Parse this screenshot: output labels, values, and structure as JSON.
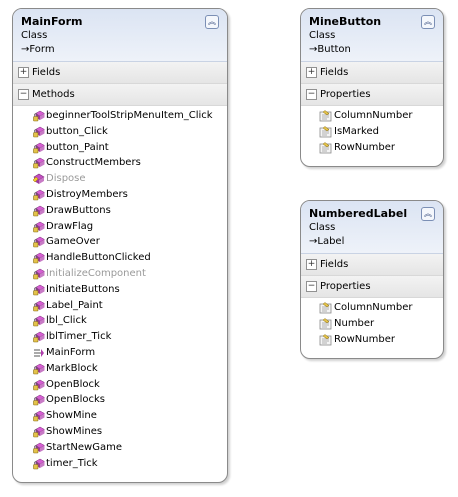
{
  "colors": {
    "header_bg": "#dbe4f3",
    "method_icon": "#b03fae",
    "lock_icon": "#c9a227",
    "dim_text": "#9a9a9a"
  },
  "main_form": {
    "name": "MainForm",
    "kind": "Class",
    "base": "→Form",
    "fields_label": "Fields",
    "methods_label": "Methods",
    "methods": [
      {
        "name": "beginnerToolStripMenuItem_Click",
        "icon": "private-method-icon"
      },
      {
        "name": "button_Click",
        "icon": "private-method-icon"
      },
      {
        "name": "button_Paint",
        "icon": "private-method-icon"
      },
      {
        "name": "ConstructMembers",
        "icon": "private-method-icon"
      },
      {
        "name": "Dispose",
        "icon": "protected-method-icon"
      },
      {
        "name": "DistroyMembers",
        "icon": "private-method-icon"
      },
      {
        "name": "DrawButtons",
        "icon": "private-method-icon"
      },
      {
        "name": "DrawFlag",
        "icon": "private-method-icon"
      },
      {
        "name": "GameOver",
        "icon": "private-method-icon"
      },
      {
        "name": "HandleButtonClicked",
        "icon": "private-method-icon"
      },
      {
        "name": "InitializeComponent",
        "icon": "private-method-icon"
      },
      {
        "name": "InitiateButtons",
        "icon": "private-method-icon"
      },
      {
        "name": "Label_Paint",
        "icon": "private-method-icon"
      },
      {
        "name": "lbl_Click",
        "icon": "private-method-icon"
      },
      {
        "name": "lblTimer_Tick",
        "icon": "private-method-icon"
      },
      {
        "name": "MainForm",
        "icon": "constructor-icon"
      },
      {
        "name": "MarkBlock",
        "icon": "private-method-icon"
      },
      {
        "name": "OpenBlock",
        "icon": "private-method-icon"
      },
      {
        "name": "OpenBlocks",
        "icon": "private-method-icon"
      },
      {
        "name": "ShowMine",
        "icon": "private-method-icon"
      },
      {
        "name": "ShowMines",
        "icon": "private-method-icon"
      },
      {
        "name": "StartNewGame",
        "icon": "private-method-icon"
      },
      {
        "name": "timer_Tick",
        "icon": "private-method-icon"
      }
    ]
  },
  "mine_button": {
    "name": "MineButton",
    "kind": "Class",
    "base": "→Button",
    "fields_label": "Fields",
    "properties_label": "Properties",
    "properties": [
      "ColumnNumber",
      "IsMarked",
      "RowNumber"
    ]
  },
  "numbered_label": {
    "name": "NumberedLabel",
    "kind": "Class",
    "base": "→Label",
    "fields_label": "Fields",
    "properties_label": "Properties",
    "properties": [
      "ColumnNumber",
      "Number",
      "RowNumber"
    ]
  }
}
